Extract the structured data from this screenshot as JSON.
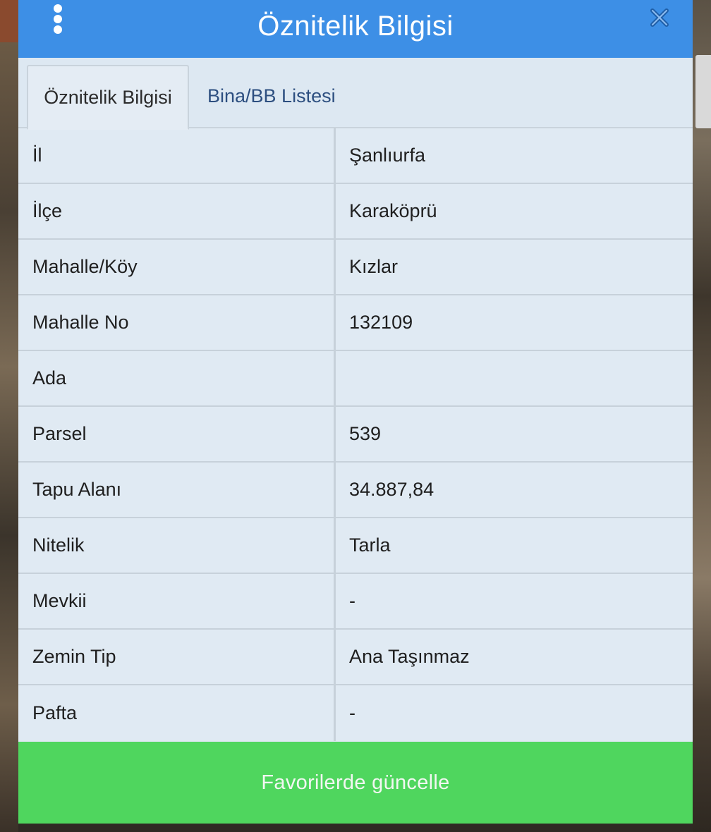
{
  "header": {
    "title": "Öznitelik Bilgisi",
    "menu_icon": "vertical-dots-icon",
    "close_icon": "close-x-icon",
    "accent_color": "#3d8fe6"
  },
  "tabs": [
    {
      "label": "Öznitelik Bilgisi",
      "active": true
    },
    {
      "label": "Bina/BB Listesi",
      "active": false
    }
  ],
  "attributes": [
    {
      "label": "İl",
      "value": "Şanlıurfa"
    },
    {
      "label": "İlçe",
      "value": "Karaköprü"
    },
    {
      "label": "Mahalle/Köy",
      "value": "Kızlar"
    },
    {
      "label": "Mahalle No",
      "value": "132109"
    },
    {
      "label": "Ada",
      "value": ""
    },
    {
      "label": "Parsel",
      "value": "539"
    },
    {
      "label": "Tapu Alanı",
      "value": "34.887,84"
    },
    {
      "label": "Nitelik",
      "value": "Tarla"
    },
    {
      "label": "Mevkii",
      "value": "-"
    },
    {
      "label": "Zemin Tip",
      "value": "Ana Taşınmaz"
    },
    {
      "label": "Pafta",
      "value": "-"
    }
  ],
  "footer": {
    "button_label": "Favorilerde güncelle",
    "button_color": "#4fd65e"
  }
}
